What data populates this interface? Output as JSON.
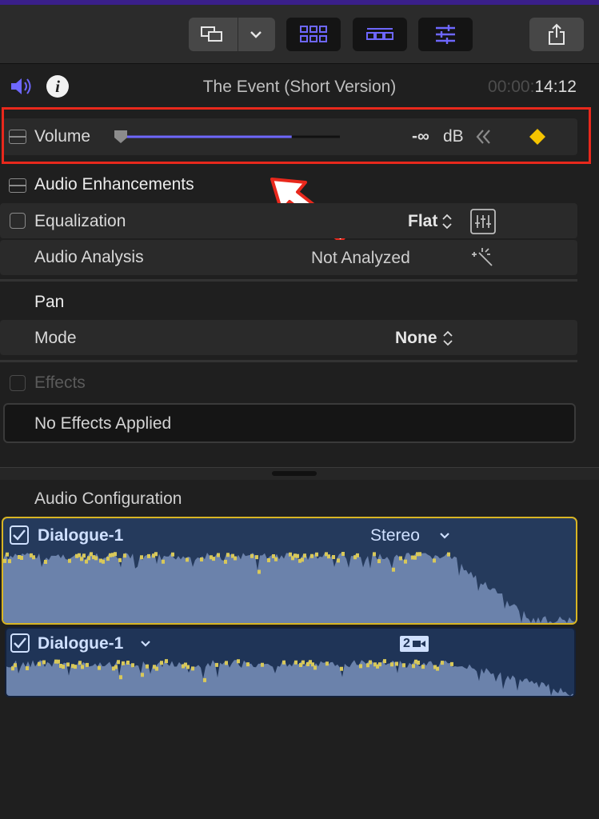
{
  "toolbar": {
    "icons": [
      "display-icon",
      "chevron-down-icon",
      "grid-icon",
      "filmstrip-icon",
      "sliders-icon",
      "share-icon"
    ],
    "accent_color": "#6e67ff"
  },
  "header": {
    "title": "The Event (Short Version)",
    "timecode_dim": "00:00:",
    "timecode": "14:12"
  },
  "volume": {
    "label": "Volume",
    "value": "-∞",
    "unit": "dB",
    "slider_fraction": 0.78,
    "keyframe_color": "#f5c400"
  },
  "audio_enhancements": {
    "label": "Audio Enhancements",
    "equalization_label": "Equalization",
    "equalization_value": "Flat",
    "analysis_label": "Audio Analysis",
    "analysis_value": "Not Analyzed"
  },
  "pan": {
    "label": "Pan",
    "mode_label": "Mode",
    "mode_value": "None"
  },
  "effects": {
    "label": "Effects",
    "empty_text": "No Effects Applied"
  },
  "audio_configuration": {
    "label": "Audio Configuration",
    "lanes": [
      {
        "name": "Dialogue-1",
        "channel": "Stereo",
        "checked": true
      },
      {
        "name": "Dialogue-1",
        "channel_badge": "2",
        "checked": true
      }
    ]
  }
}
